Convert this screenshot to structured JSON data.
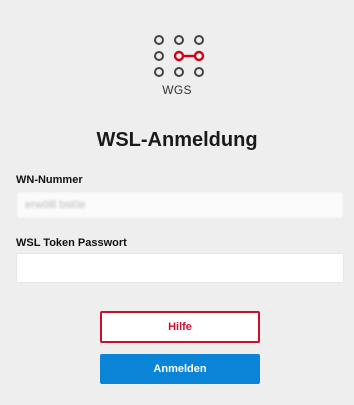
{
  "logo": {
    "text": "WGS",
    "accent_color": "#d0021b",
    "dot_color": "#444444"
  },
  "title": "WSL-Anmeldung",
  "wn_field": {
    "label": "WN-Nummer",
    "value": "erwölll bsl0e"
  },
  "token_field": {
    "label": "WSL Token Passwort",
    "value": ""
  },
  "buttons": {
    "help_label": "Hilfe",
    "login_label": "Anmelden"
  },
  "colors": {
    "background": "#eeeeee",
    "primary": "#0a84d6",
    "danger": "#c8102e"
  }
}
